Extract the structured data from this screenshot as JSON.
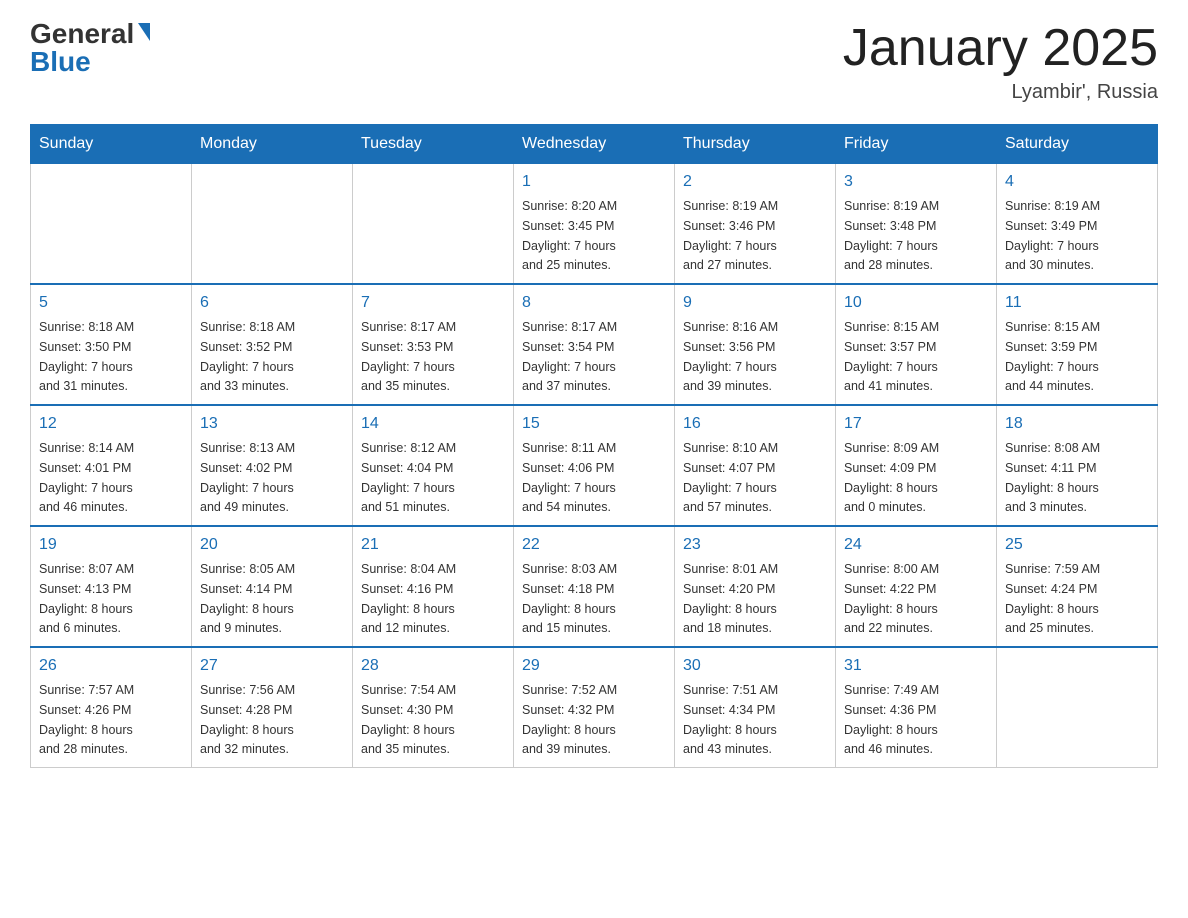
{
  "header": {
    "logo_general": "General",
    "logo_blue": "Blue",
    "title": "January 2025",
    "location": "Lyambir', Russia"
  },
  "weekdays": [
    "Sunday",
    "Monday",
    "Tuesday",
    "Wednesday",
    "Thursday",
    "Friday",
    "Saturday"
  ],
  "weeks": [
    [
      {
        "day": "",
        "info": ""
      },
      {
        "day": "",
        "info": ""
      },
      {
        "day": "",
        "info": ""
      },
      {
        "day": "1",
        "info": "Sunrise: 8:20 AM\nSunset: 3:45 PM\nDaylight: 7 hours\nand 25 minutes."
      },
      {
        "day": "2",
        "info": "Sunrise: 8:19 AM\nSunset: 3:46 PM\nDaylight: 7 hours\nand 27 minutes."
      },
      {
        "day": "3",
        "info": "Sunrise: 8:19 AM\nSunset: 3:48 PM\nDaylight: 7 hours\nand 28 minutes."
      },
      {
        "day": "4",
        "info": "Sunrise: 8:19 AM\nSunset: 3:49 PM\nDaylight: 7 hours\nand 30 minutes."
      }
    ],
    [
      {
        "day": "5",
        "info": "Sunrise: 8:18 AM\nSunset: 3:50 PM\nDaylight: 7 hours\nand 31 minutes."
      },
      {
        "day": "6",
        "info": "Sunrise: 8:18 AM\nSunset: 3:52 PM\nDaylight: 7 hours\nand 33 minutes."
      },
      {
        "day": "7",
        "info": "Sunrise: 8:17 AM\nSunset: 3:53 PM\nDaylight: 7 hours\nand 35 minutes."
      },
      {
        "day": "8",
        "info": "Sunrise: 8:17 AM\nSunset: 3:54 PM\nDaylight: 7 hours\nand 37 minutes."
      },
      {
        "day": "9",
        "info": "Sunrise: 8:16 AM\nSunset: 3:56 PM\nDaylight: 7 hours\nand 39 minutes."
      },
      {
        "day": "10",
        "info": "Sunrise: 8:15 AM\nSunset: 3:57 PM\nDaylight: 7 hours\nand 41 minutes."
      },
      {
        "day": "11",
        "info": "Sunrise: 8:15 AM\nSunset: 3:59 PM\nDaylight: 7 hours\nand 44 minutes."
      }
    ],
    [
      {
        "day": "12",
        "info": "Sunrise: 8:14 AM\nSunset: 4:01 PM\nDaylight: 7 hours\nand 46 minutes."
      },
      {
        "day": "13",
        "info": "Sunrise: 8:13 AM\nSunset: 4:02 PM\nDaylight: 7 hours\nand 49 minutes."
      },
      {
        "day": "14",
        "info": "Sunrise: 8:12 AM\nSunset: 4:04 PM\nDaylight: 7 hours\nand 51 minutes."
      },
      {
        "day": "15",
        "info": "Sunrise: 8:11 AM\nSunset: 4:06 PM\nDaylight: 7 hours\nand 54 minutes."
      },
      {
        "day": "16",
        "info": "Sunrise: 8:10 AM\nSunset: 4:07 PM\nDaylight: 7 hours\nand 57 minutes."
      },
      {
        "day": "17",
        "info": "Sunrise: 8:09 AM\nSunset: 4:09 PM\nDaylight: 8 hours\nand 0 minutes."
      },
      {
        "day": "18",
        "info": "Sunrise: 8:08 AM\nSunset: 4:11 PM\nDaylight: 8 hours\nand 3 minutes."
      }
    ],
    [
      {
        "day": "19",
        "info": "Sunrise: 8:07 AM\nSunset: 4:13 PM\nDaylight: 8 hours\nand 6 minutes."
      },
      {
        "day": "20",
        "info": "Sunrise: 8:05 AM\nSunset: 4:14 PM\nDaylight: 8 hours\nand 9 minutes."
      },
      {
        "day": "21",
        "info": "Sunrise: 8:04 AM\nSunset: 4:16 PM\nDaylight: 8 hours\nand 12 minutes."
      },
      {
        "day": "22",
        "info": "Sunrise: 8:03 AM\nSunset: 4:18 PM\nDaylight: 8 hours\nand 15 minutes."
      },
      {
        "day": "23",
        "info": "Sunrise: 8:01 AM\nSunset: 4:20 PM\nDaylight: 8 hours\nand 18 minutes."
      },
      {
        "day": "24",
        "info": "Sunrise: 8:00 AM\nSunset: 4:22 PM\nDaylight: 8 hours\nand 22 minutes."
      },
      {
        "day": "25",
        "info": "Sunrise: 7:59 AM\nSunset: 4:24 PM\nDaylight: 8 hours\nand 25 minutes."
      }
    ],
    [
      {
        "day": "26",
        "info": "Sunrise: 7:57 AM\nSunset: 4:26 PM\nDaylight: 8 hours\nand 28 minutes."
      },
      {
        "day": "27",
        "info": "Sunrise: 7:56 AM\nSunset: 4:28 PM\nDaylight: 8 hours\nand 32 minutes."
      },
      {
        "day": "28",
        "info": "Sunrise: 7:54 AM\nSunset: 4:30 PM\nDaylight: 8 hours\nand 35 minutes."
      },
      {
        "day": "29",
        "info": "Sunrise: 7:52 AM\nSunset: 4:32 PM\nDaylight: 8 hours\nand 39 minutes."
      },
      {
        "day": "30",
        "info": "Sunrise: 7:51 AM\nSunset: 4:34 PM\nDaylight: 8 hours\nand 43 minutes."
      },
      {
        "day": "31",
        "info": "Sunrise: 7:49 AM\nSunset: 4:36 PM\nDaylight: 8 hours\nand 46 minutes."
      },
      {
        "day": "",
        "info": ""
      }
    ]
  ]
}
